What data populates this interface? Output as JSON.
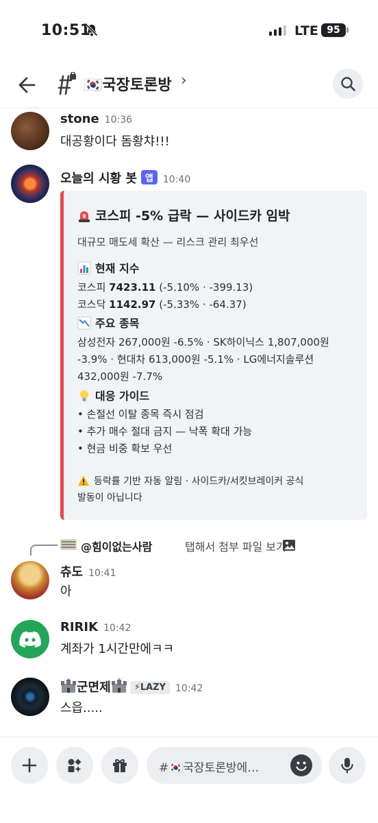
{
  "status_bar": {
    "time": "10:51",
    "network": "LTE",
    "battery": "95"
  },
  "header": {
    "channel_name": "🇰🇷국장토론방",
    "chevron": "›"
  },
  "messages": [
    {
      "author": "stone",
      "time": "10:36",
      "text": "대공황이다 돔황챠!!!"
    },
    {
      "author": "오늘의 시황 봇",
      "badge": "앱",
      "time": "10:40"
    },
    {
      "author": "츄도",
      "time": "10:41",
      "text": "아"
    },
    {
      "author": "RIRIK",
      "time": "10:42",
      "text": "계좌가 1시간만에ㅋㅋ"
    },
    {
      "author": "군면제",
      "badge": "⚡LAZY",
      "time": "10:42",
      "text": "스읍....."
    }
  ],
  "embed": {
    "title": "코스피 -5% 급락 — 사이드카 임박",
    "description": "대규모 매도세 확산 — 리스크 관리 최우선",
    "index_heading": "현재 지수",
    "kospi_label": "코스피 ",
    "kospi_value": "7423.11",
    "kospi_change": " (-5.10% · -399.13)",
    "kosdaq_label": "코스닥 ",
    "kosdaq_value": "1142.97",
    "kosdaq_change": " (-5.33% · -64.37)",
    "stocks_heading": "주요 종목",
    "stocks_line1": "삼성전자 267,000원 -6.5% · SK하이닉스 1,807,000원",
    "stocks_line2": "-3.9% · 현대차 613,000원 -5.1% · LG에너지솔루션",
    "stocks_line3": "432,000원 -7.7%",
    "guide_heading": "대응 가이드",
    "guide_items": [
      "• 손절선 이탈 종목 즉시 점검",
      "• 추가 매수 절대 금지 — 낙폭 확대 가능",
      "• 현금 비중 확보 우선"
    ],
    "footer_line1": "등락률 기반 자동 알림 · 사이드카/서킷브레이커 공식",
    "footer_line2": "발동이 아닙니다",
    "accent_color": "#e5484d"
  },
  "reply": {
    "mention": "@힘이없는사람",
    "text": "탭해서 첨부 파일 보기"
  },
  "composer": {
    "placeholder": "#🇰🇷국장토론방에…"
  },
  "icons": [
    "back-arrow-icon",
    "hash-lock-icon",
    "search-icon",
    "plus-icon",
    "apps-icon",
    "gift-icon",
    "smile-icon",
    "mic-icon",
    "bell-muted-icon",
    "image-icon",
    "discord-logo-icon"
  ],
  "colors": {
    "brand": "#5865f2",
    "discord_green": "#23a55a",
    "embed_bg": "#f2f3f5"
  }
}
